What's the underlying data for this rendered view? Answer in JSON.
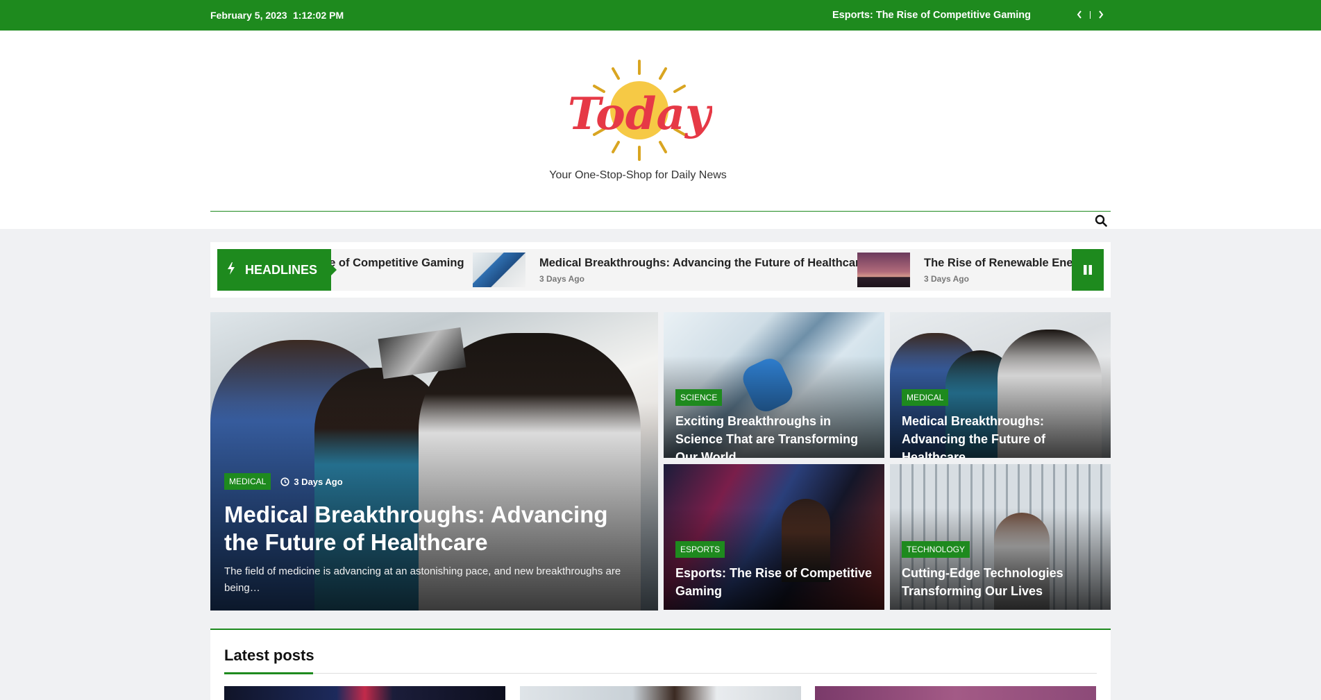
{
  "topbar": {
    "date": "February 5, 2023",
    "time": "1:12:02 PM",
    "ticker": "Esports: The Rise of Competitive Gaming",
    "prev_icon": "chevron-left-icon",
    "next_icon": "chevron-right-icon"
  },
  "header": {
    "logo_text": "Today",
    "tagline": "Your One-Stop-Shop for Daily News",
    "search_icon": "search-icon"
  },
  "headlines": {
    "label": "HEADLINES",
    "label_icon": "bolt-icon",
    "pause_icon": "pause-icon",
    "items": [
      {
        "title": "Esports: The Rise of Competitive Gaming",
        "visible_text": "se of Competitive Gaming"
      },
      {
        "title": "Medical Breakthroughs: Advancing the Future of Healthcare",
        "time": "3 Days Ago"
      },
      {
        "title": "The Rise of Renewable Energy",
        "visible_text": "The Rise of Renewable Energy",
        "time": "3 Days Ago"
      }
    ]
  },
  "featured": {
    "category": "MEDICAL",
    "time": "3 Days Ago",
    "clock_icon": "clock-icon",
    "title": "Medical Breakthroughs: Advancing the Future of Healthcare",
    "excerpt": "The field of medicine is advancing at an astonishing pace, and new breakthroughs are being…"
  },
  "cards": [
    {
      "category": "SCIENCE",
      "title": "Exciting Breakthroughs in Science That are Transforming Our World"
    },
    {
      "category": "MEDICAL",
      "title": "Medical Breakthroughs: Advancing the Future of Healthcare"
    },
    {
      "category": "ESPORTS",
      "title": "Esports: The Rise of Competitive Gaming"
    },
    {
      "category": "TECHNOLOGY",
      "title": "Cutting-Edge Technologies Transforming Our Lives"
    }
  ],
  "latest": {
    "heading": "Latest posts"
  },
  "colors": {
    "accent": "#1e8a1e",
    "logo_red": "#e63946",
    "logo_sun": "#f6c945"
  }
}
